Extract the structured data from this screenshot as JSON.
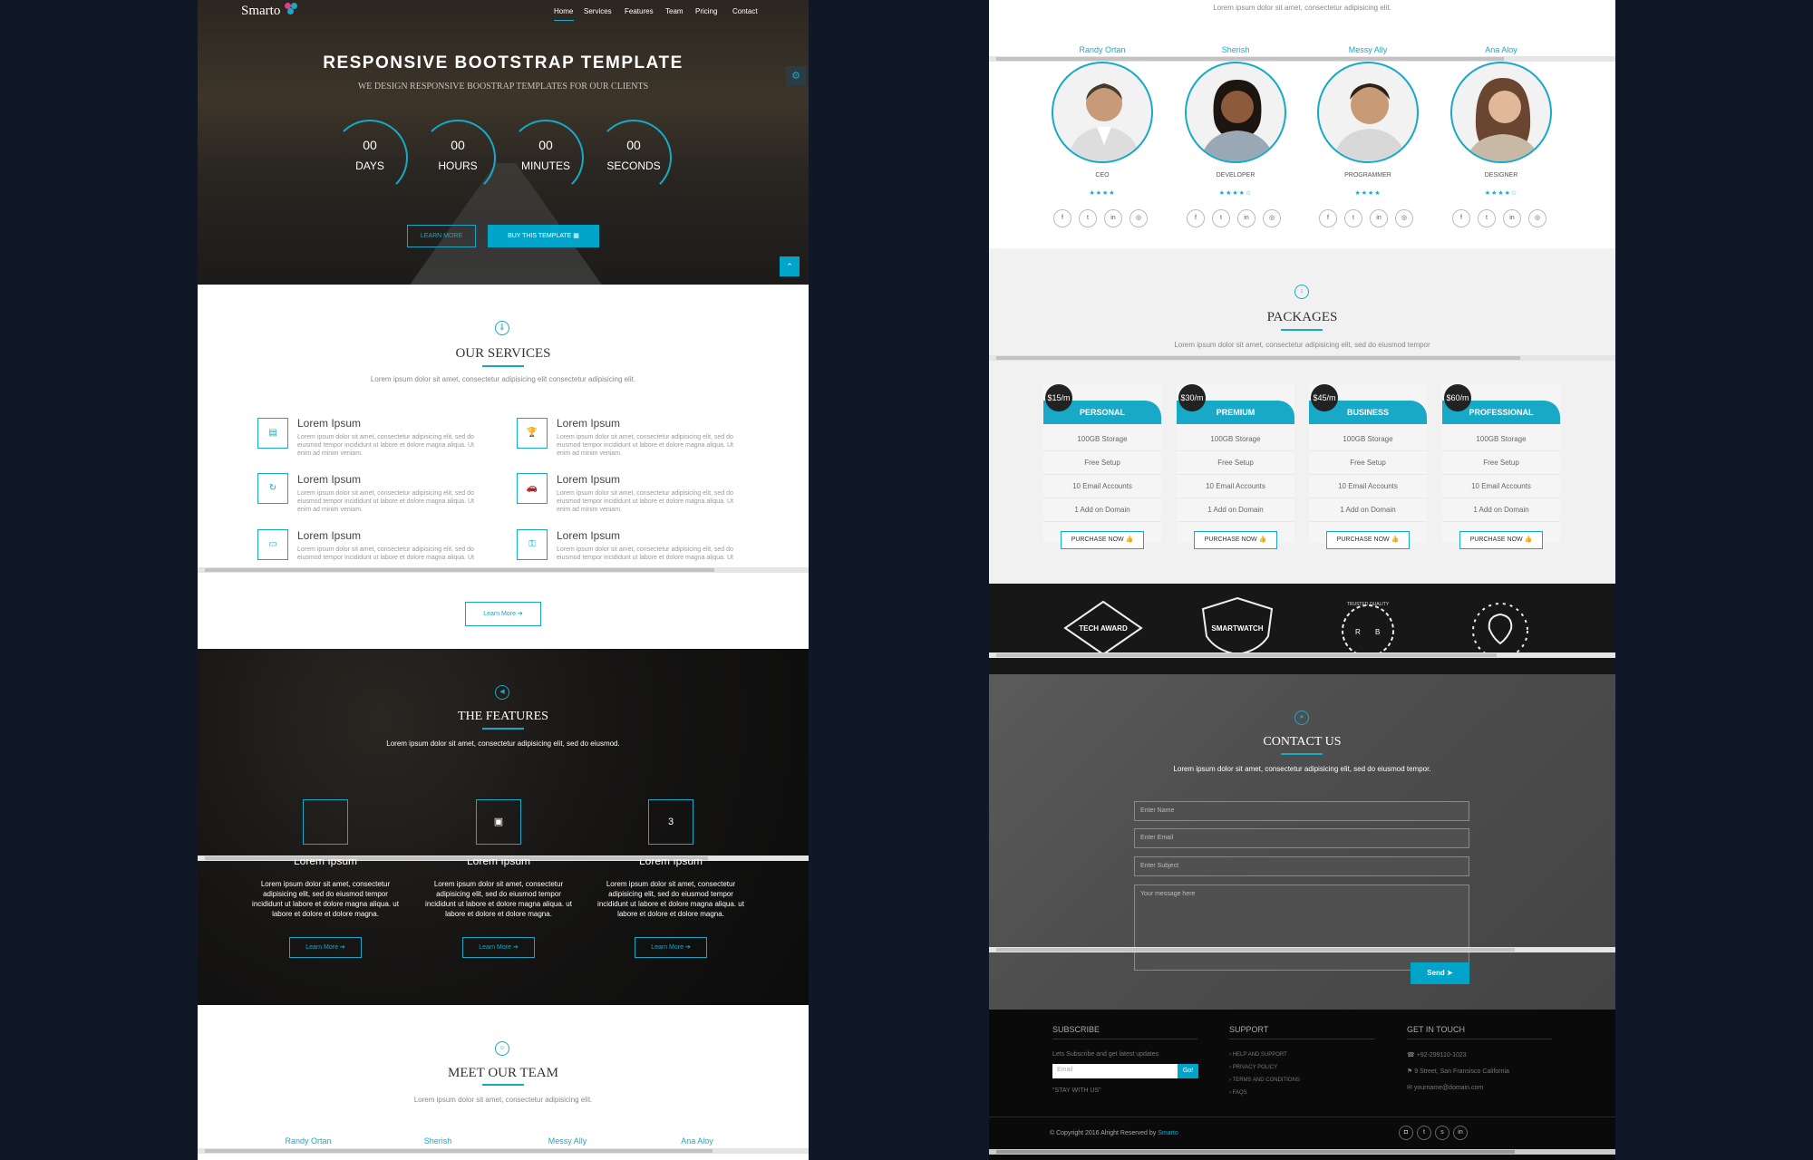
{
  "nav": {
    "brand": "Smarto",
    "items": [
      "Home",
      "Services",
      "Features",
      "Team",
      "Pricing",
      "Contact"
    ]
  },
  "hero": {
    "title": "RESPONSIVE BOOTSTRAP TEMPLATE",
    "subtitle": "WE DESIGN RESPONSIVE BOOSTRAP TEMPLATES FOR OUR CLIENTS",
    "countdown": [
      {
        "value": "00",
        "label": "DAYS"
      },
      {
        "value": "00",
        "label": "HOURS"
      },
      {
        "value": "00",
        "label": "MINUTES"
      },
      {
        "value": "00",
        "label": "SECONDS"
      }
    ],
    "learn_more": "LEARN MORE",
    "buy": "BUY THIS TEMPLATE"
  },
  "services": {
    "title": "OUR SERVICES",
    "subtitle": "Lorem ipsum dolor sit amet, consectetur adipisicing elit consectetur adipisicing elit.",
    "items": [
      {
        "title": "Lorem Ipsum",
        "text": "Lorem ipsum dolor sit amet, consectetur adipisicing elit, sed do eiusmod tempor incididunt ut labore et dolore magna aliqua. Ut enim ad minim veniam."
      },
      {
        "title": "Lorem Ipsum",
        "text": "Lorem ipsum dolor sit amet, consectetur adipisicing elit, sed do eiusmod tempor incididunt ut labore et dolore magna aliqua. Ut enim ad minim veniam."
      },
      {
        "title": "Lorem Ipsum",
        "text": "Lorem ipsum dolor sit amet, consectetur adipisicing elit, sed do eiusmod tempor incididunt ut labore et dolore magna aliqua. Ut enim ad minim veniam."
      },
      {
        "title": "Lorem Ipsum",
        "text": "Lorem ipsum dolor sit amet, consectetur adipisicing elit, sed do eiusmod tempor incididunt ut labore et dolore magna aliqua. Ut enim ad minim veniam."
      },
      {
        "title": "Lorem Ipsum",
        "text": "Lorem ipsum dolor sit amet, consectetur adipisicing elit, sed do eiusmod tempor incididunt ut labore et dolore magna aliqua. Ut enim ad minim veniam."
      },
      {
        "title": "Lorem Ipsum",
        "text": "Lorem ipsum dolor sit amet, consectetur adipisicing elit, sed do eiusmod tempor incididunt ut labore et dolore magna aliqua. Ut enim ad minim veniam."
      }
    ],
    "learn_more": "Learn More"
  },
  "features": {
    "title": "THE FEATURES",
    "subtitle": "Lorem ipsum dolor sit amet, consectetur adipisicing elit, sed do eiusmod.",
    "items": [
      {
        "title": "Lorem Ipsum",
        "text": "Lorem ipsum dolor sit amet, consectetur adipisicing elit, sed do eiusmod tempor incididunt ut labore et dolore magna aliqua. ut labore et dolore et dolore magna.",
        "button": "Learn More"
      },
      {
        "title": "Lorem Ipsum",
        "text": "Lorem ipsum dolor sit amet, consectetur adipisicing elit, sed do eiusmod tempor incididunt ut labore et dolore magna aliqua. ut labore et dolore et dolore magna.",
        "button": "Learn More"
      },
      {
        "title": "Lorem Ipsum",
        "text": "Lorem ipsum dolor sit amet, consectetur adipisicing elit, sed do eiusmod tempor incididunt ut labore et dolore magna aliqua. ut labore et dolore et dolore magna.",
        "button": "Learn More"
      }
    ]
  },
  "team": {
    "title": "MEET OUR TEAM",
    "subtitle": "Lorem ipsum dolor sit amet, consectetur adipisicing elit.",
    "right_subtitle": "Lorem ipsum dolor sit amet, consectetur adipisicing elit.",
    "members": [
      {
        "name": "Randy Ortan",
        "role": "CEO",
        "stars": "★★★★"
      },
      {
        "name": "Sherish",
        "role": "DEVELOPER",
        "stars": "★★★★☆"
      },
      {
        "name": "Messy Ally",
        "role": "PROGRAMMER",
        "stars": "★★★★"
      },
      {
        "name": "Ana Aloy",
        "role": "DESIGNER",
        "stars": "★★★★☆"
      }
    ],
    "left_names": [
      "Randy Ortan",
      "Sherish",
      "Messy Ally",
      "Ana Aloy"
    ]
  },
  "packages": {
    "title": "PACKAGES",
    "subtitle": "Lorem ipsum dolor sit amet, consectetur adipisicing elit, sed do eiusmod tempor",
    "plans": [
      {
        "name": "PERSONAL",
        "price": "$15/m"
      },
      {
        "name": "PREMIUM",
        "price": "$30/m"
      },
      {
        "name": "BUSINESS",
        "price": "$45/m"
      },
      {
        "name": "PROFESSIONAL",
        "price": "$60/m"
      }
    ],
    "features": [
      "100GB Storage",
      "Free Setup",
      "10 Email Accounts",
      "1 Add on Domain"
    ],
    "button": "PURCHASE NOW"
  },
  "badges": [
    "TECH AWARD",
    "SMARTWATCH",
    "TRUSTED QUALITY",
    "BALLOON"
  ],
  "contact": {
    "title": "CONTACT US",
    "subtitle": "Lorem ipsum dolor sit amet, consectetur adipisicing elit, sed do eiusmod tempor.",
    "name_ph": "Enter Name",
    "email_ph": "Enter Email",
    "subject_ph": "Enter Subject",
    "message_ph": "Your message here",
    "send": "Send"
  },
  "footer": {
    "subscribe_title": "SUBSCRIBE",
    "subscribe_text": "Lets Subscribe and get latest updates",
    "email_ph": "Email",
    "go": "Go!",
    "stay": "\"STAY WITH US\"",
    "support_title": "SUPPORT",
    "support_links": [
      "HELP AND SUPPORT",
      "PRIVACY POLICY",
      "TERMS AND CONDITIONS",
      "FAQS"
    ],
    "touch_title": "GET IN TOUCH",
    "phone": "+92-299110-1023",
    "address": "9 Street, San Fransisco California",
    "email": "yourname@domain.com",
    "copyright": "© Copyright 2016 Alright Reserved by",
    "brand": "Smarto"
  },
  "colors": {
    "accent": "#18a9c7",
    "bg": "#101828"
  }
}
